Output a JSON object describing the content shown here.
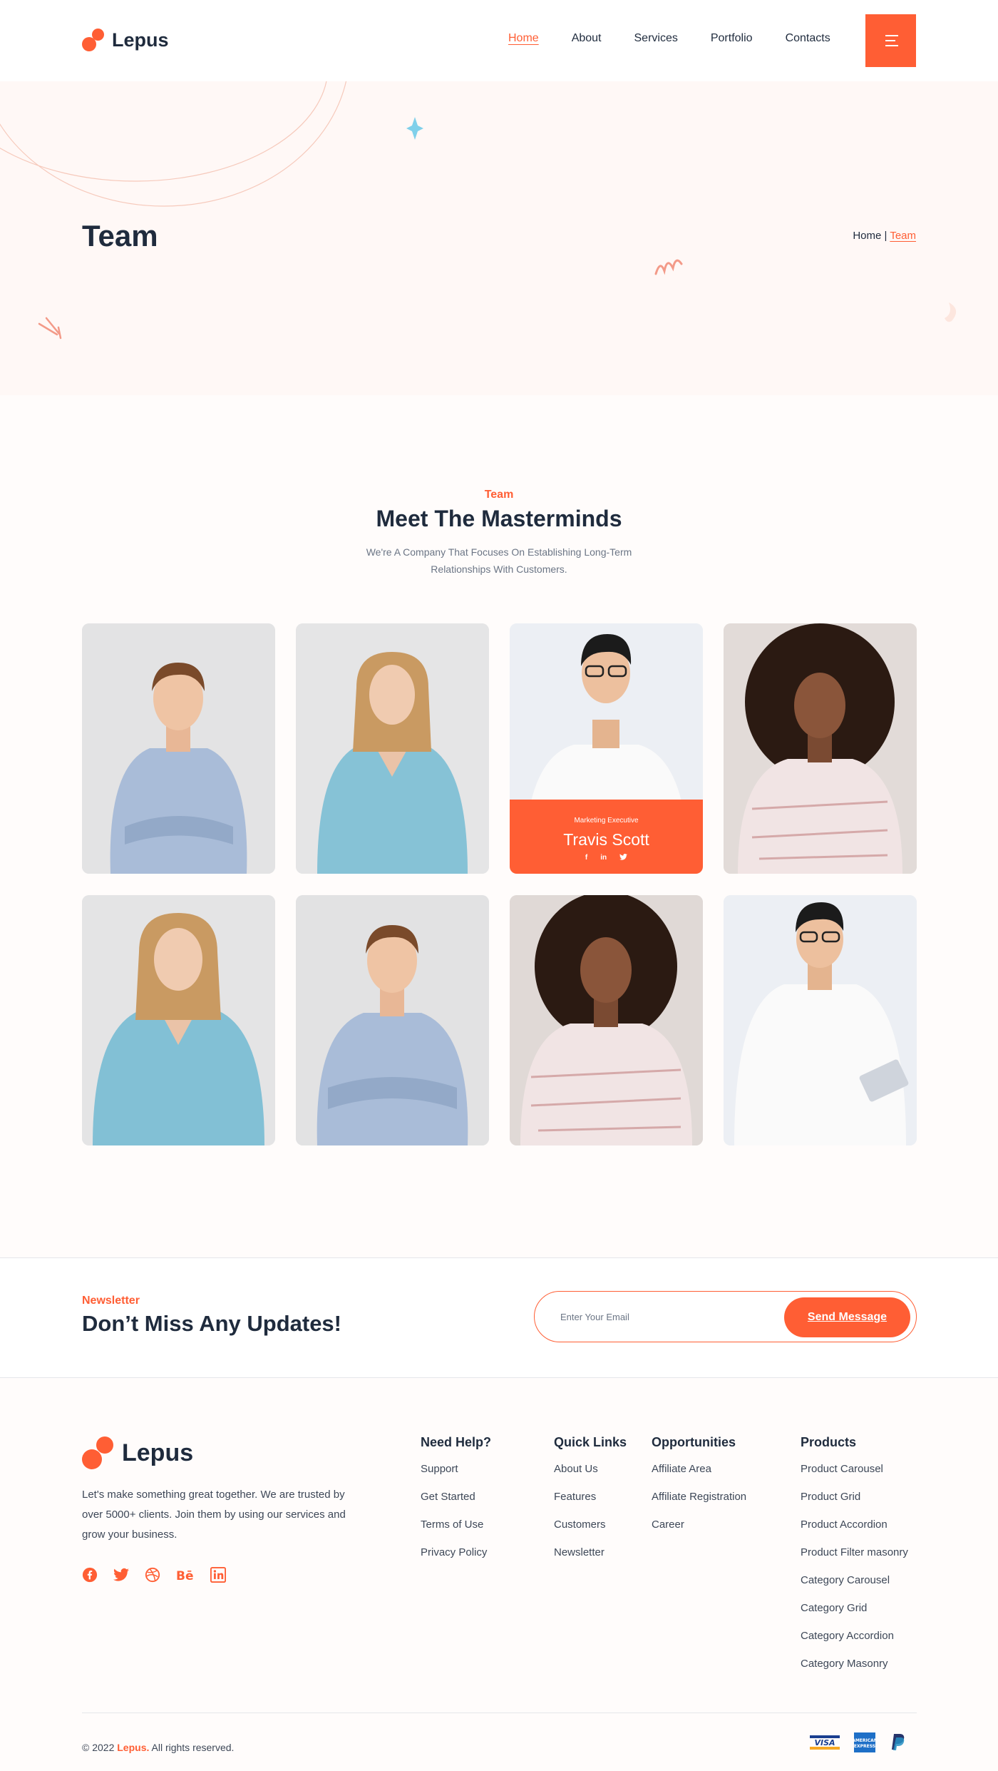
{
  "brand": {
    "name": "Lepus",
    "accent": "#ff5e34",
    "dark": "#1f2b3d"
  },
  "nav": {
    "items": [
      "Home",
      "About",
      "Services",
      "Portfolio",
      "Contacts"
    ],
    "active": "Home",
    "menu_icon": "hamburger-icon"
  },
  "hero": {
    "title": "Team",
    "breadcrumb": {
      "home": "Home",
      "separator": "|",
      "current": "Team"
    }
  },
  "team": {
    "eyebrow": "Team",
    "title": "Meet The Masterminds",
    "description": "We're A Company That Focuses On Establishing Long-Term Relationships With Customers.",
    "highlight": {
      "role": "Marketing Executive",
      "name": "Travis Scott",
      "social": [
        "f",
        "in",
        "twitter"
      ]
    },
    "members": [
      {
        "photo": "young man in blue shirt, arms crossed"
      },
      {
        "photo": "young woman in light blue sweater"
      },
      {
        "photo": "man with glasses in white shirt"
      },
      {
        "photo": "woman with curly hair in striped shirt"
      },
      {
        "photo": "young woman in light blue sweater"
      },
      {
        "photo": "young man in blue shirt, arms crossed"
      },
      {
        "photo": "woman with curly hair in striped shirt"
      },
      {
        "photo": "man with glasses holding tablet"
      }
    ]
  },
  "newsletter": {
    "eyebrow": "Newsletter",
    "title": "Don’t Miss Any Updates!",
    "placeholder": "Enter Your Email",
    "button": "Send Message"
  },
  "footer": {
    "about": "Let's make something great together. We are trusted by over 5000+ clients. Join them by using our services and grow your business.",
    "social_icons": [
      "facebook-icon",
      "twitter-icon",
      "dribbble-icon",
      "behance-icon",
      "linkedin-icon"
    ],
    "columns": [
      {
        "title": "Need Help?",
        "links": [
          "Support",
          "Get Started",
          "Terms of Use",
          "Privacy Policy"
        ]
      },
      {
        "title": "Quick Links",
        "links": [
          "About Us",
          "Features",
          "Customers",
          "Newsletter"
        ]
      },
      {
        "title": "Opportunities",
        "links": [
          "Affiliate Area",
          "Affiliate Registration",
          "Career"
        ]
      },
      {
        "title": "Products",
        "links": [
          "Product Carousel",
          "Product Grid",
          "Product Accordion",
          "Product Filter masonry",
          "Category Carousel",
          "Category Grid",
          "Category Accordion",
          "Category Masonry"
        ]
      }
    ],
    "copyright": {
      "prefix": "© 2022",
      "brand": "Lepus.",
      "suffix": "All rights reserved."
    },
    "payments": [
      "visa-icon",
      "amex-icon",
      "paypal-icon"
    ]
  }
}
